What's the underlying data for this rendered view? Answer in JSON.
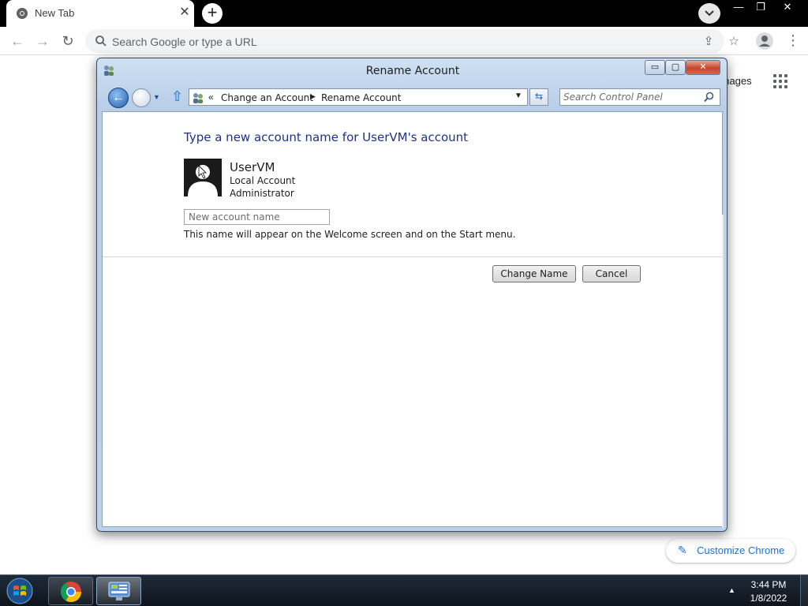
{
  "chrome": {
    "tab_title": "New Tab",
    "tab_close": "✕",
    "new_tab": "+",
    "window_minimize": "—",
    "window_restore": "❐",
    "window_close": "✕",
    "omnibox_placeholder": "Search Google or type a URL",
    "ntp_images_label": "Images",
    "customize_label": "Customize Chrome"
  },
  "dialog": {
    "title": "Rename Account",
    "minimize": "▭",
    "maximize": "▢",
    "close": "✕",
    "breadcrumb": {
      "overflow": "«",
      "items": [
        "Change an Account",
        "Rename Account"
      ]
    },
    "search_placeholder": "Search Control Panel",
    "heading": "Type a new account name for UserVM's account",
    "account": {
      "name": "UserVM",
      "type": "Local Account",
      "role": "Administrator"
    },
    "new_name_placeholder": "New account name",
    "new_name_value": "",
    "hint": "This name will appear on the Welcome screen and on the Start menu.",
    "change_button": "Change Name",
    "cancel_button": "Cancel"
  },
  "taskbar": {
    "time": "3:44 PM",
    "date": "1/8/2022"
  },
  "colors": {
    "heading": "#1e3287",
    "chrome_accent": "#1a73e8",
    "dialog_frame": "#b9cfe8",
    "close_red": "#c5452b"
  },
  "icons": {
    "tab_favicon": "chrome-icon",
    "back": "back-arrow-icon",
    "forward": "forward-arrow-icon",
    "reload": "reload-icon",
    "share": "share-icon",
    "bookmark": "star-icon",
    "profile": "profile-icon",
    "menu": "kebab-menu-icon",
    "apps": "apps-grid-icon",
    "user_accounts": "user-accounts-icon",
    "up": "up-arrow-icon",
    "refresh": "refresh-icon",
    "search": "search-icon",
    "avatar": "user-silhouette-icon",
    "start": "windows-orb-icon"
  }
}
